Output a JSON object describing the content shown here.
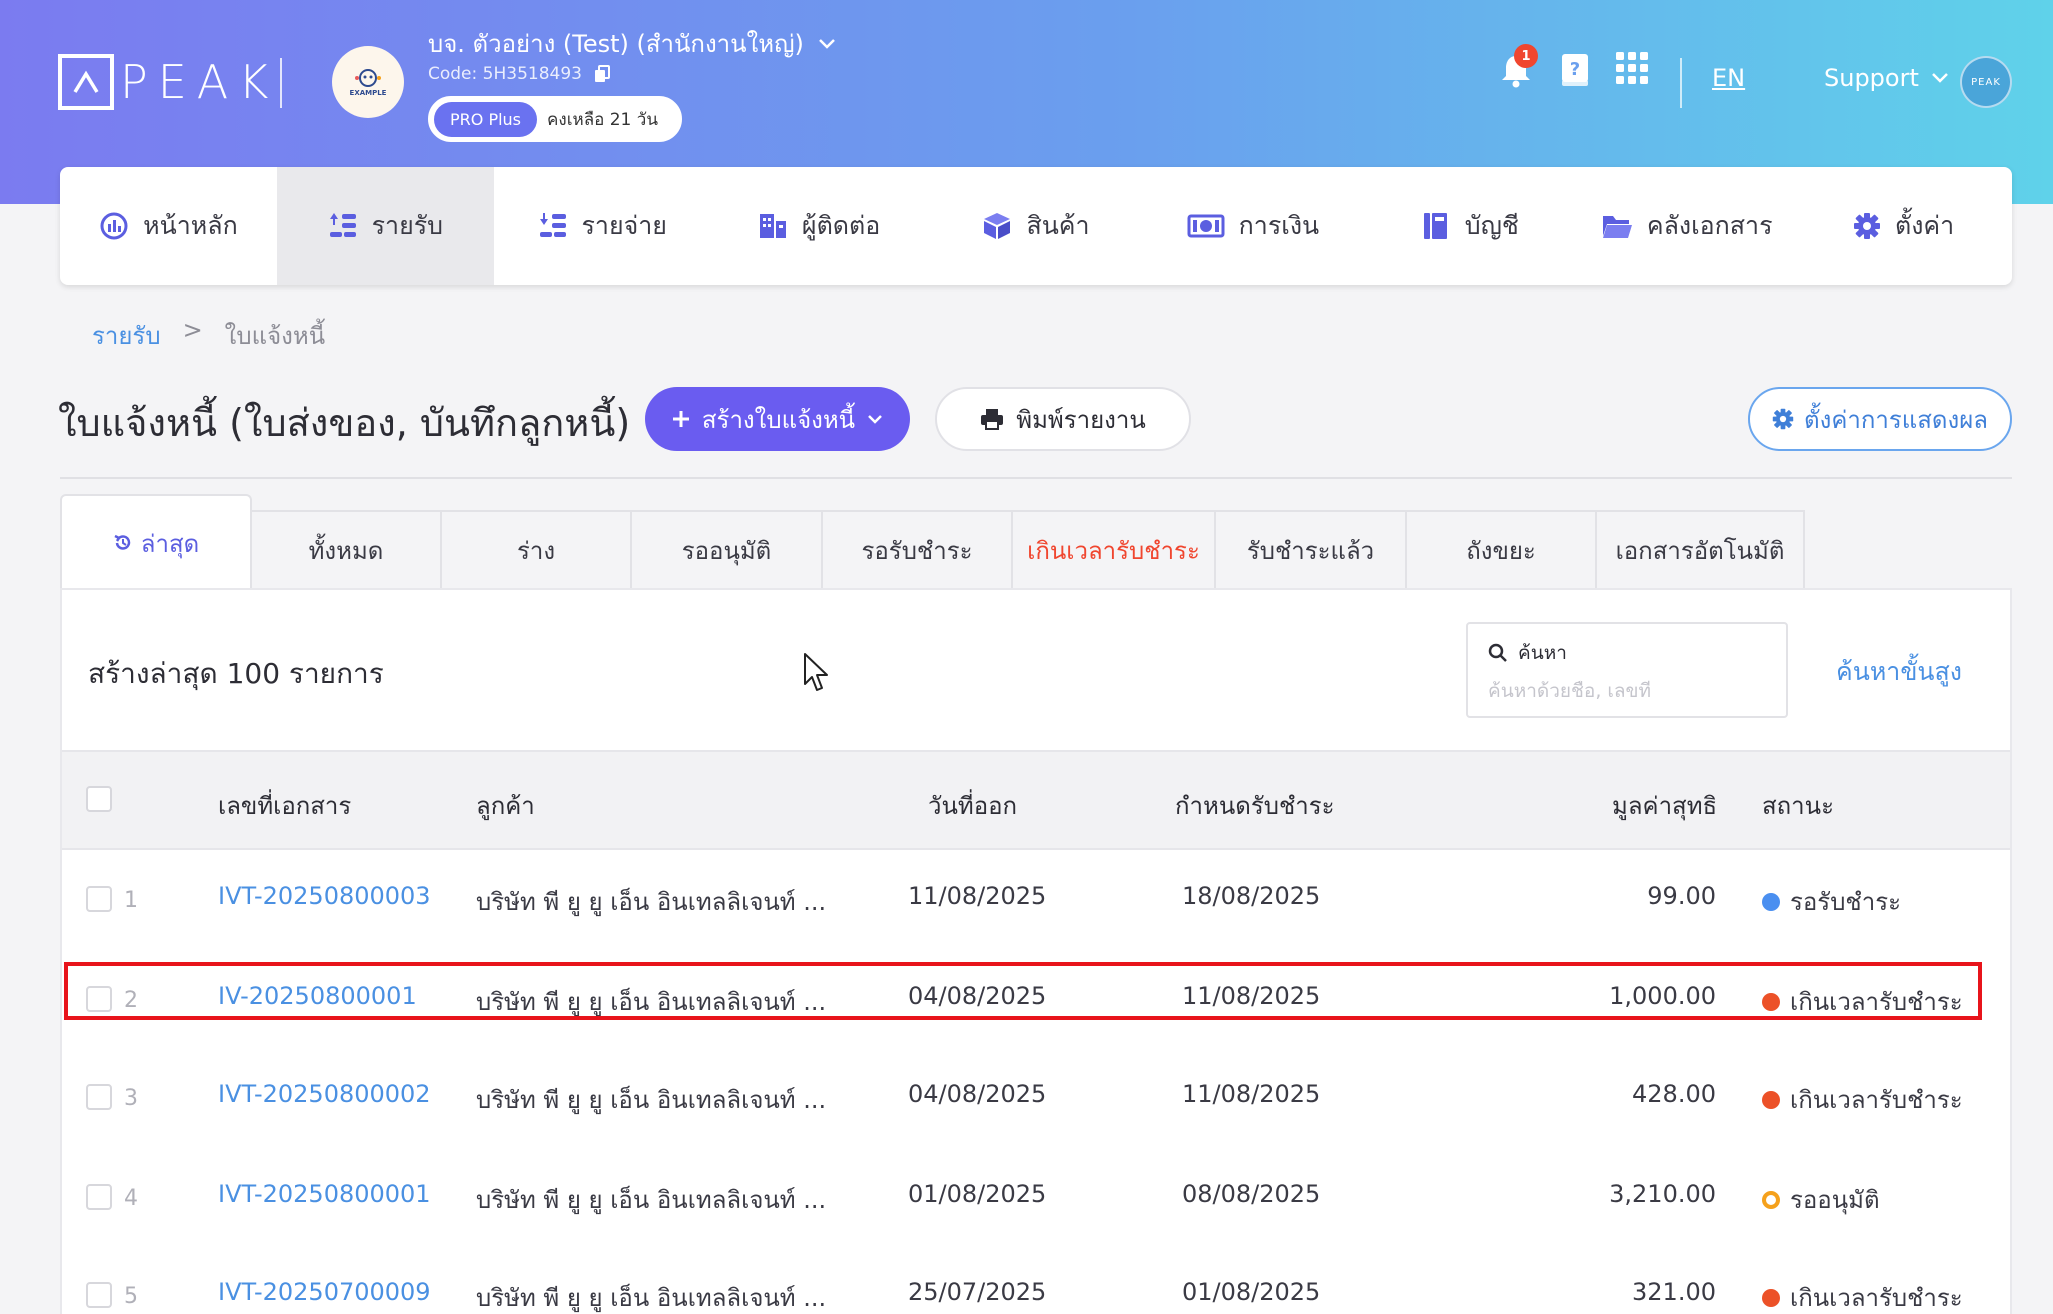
{
  "header": {
    "logo_text": "PEAK",
    "company_avatar_text": "EXAMPLE",
    "company_name": "บจ. ตัวอย่าง (Test) (สำนักงานใหญ่)",
    "company_code": "Code: 5H3518493",
    "plan": "PRO Plus",
    "days_left": "คงเหลือ 21 วัน",
    "notification_count": "1",
    "language": "EN",
    "support": "Support",
    "user_avatar_text": "PEAK"
  },
  "nav": {
    "items": [
      {
        "label": "หน้าหลัก",
        "icon": "dashboard-icon"
      },
      {
        "label": "รายรับ",
        "icon": "income-icon"
      },
      {
        "label": "รายจ่าย",
        "icon": "expense-icon"
      },
      {
        "label": "ผู้ติดต่อ",
        "icon": "contacts-icon"
      },
      {
        "label": "สินค้า",
        "icon": "product-icon"
      },
      {
        "label": "การเงิน",
        "icon": "finance-icon"
      },
      {
        "label": "บัญชี",
        "icon": "accounting-icon"
      },
      {
        "label": "คลังเอกสาร",
        "icon": "folder-icon"
      },
      {
        "label": "ตั้งค่า",
        "icon": "gear-icon"
      }
    ],
    "active_index": 1
  },
  "breadcrumb": {
    "parent": "รายรับ",
    "separator": ">",
    "current": "ใบแจ้งหนี้"
  },
  "page": {
    "title": "ใบแจ้งหนี้ (ใบส่งของ, บันทึกลูกหนี้)",
    "create_button": "สร้างใบแจ้งหนี้",
    "print_button": "พิมพ์รายงาน",
    "display_settings_button": "ตั้งค่าการแสดงผล"
  },
  "tabs": [
    {
      "label": "ล่าสุด",
      "width": 146
    },
    {
      "label": "ทั้งหมด",
      "width": 145
    },
    {
      "label": "ร่าง",
      "width": 145
    },
    {
      "label": "รออนุมัติ",
      "width": 146
    },
    {
      "label": "รอรับชำระ",
      "width": 145
    },
    {
      "label": "เกินเวลารับชำระ",
      "width": 155
    },
    {
      "label": "รับชำระแล้ว",
      "width": 146
    },
    {
      "label": "ถังขยะ",
      "width": 145
    },
    {
      "label": "เอกสารอัตโนมัติ",
      "width": 159
    }
  ],
  "list": {
    "summary": "สร้างล่าสุด 100 รายการ",
    "search_label": "ค้นหา",
    "search_placeholder": "ค้นหาด้วยชื่อ, เลขที่",
    "advanced_search": "ค้นหาขั้นสูง",
    "columns": {
      "doc_no": "เลขที่เอกสาร",
      "customer": "ลูกค้า",
      "issue_date": "วันที่ออก",
      "due_date": "กำหนดรับชำระ",
      "net_amount": "มูลค่าสุทธิ",
      "status": "สถานะ"
    },
    "rows": [
      {
        "num": "1",
        "doc": "IVT-20250800003",
        "customer": "บริษัท พี ยู ยู เอ็น อินเทลลิเจนท์ ...",
        "issue": "11/08/2025",
        "due": "18/08/2025",
        "amount": "99.00",
        "status": "รอรับชำระ",
        "status_color": "#4a8ff0",
        "ring": false
      },
      {
        "num": "2",
        "doc": "IV-20250800001",
        "customer": "บริษัท พี ยู ยู เอ็น อินเทลลิเจนท์ ...",
        "issue": "04/08/2025",
        "due": "11/08/2025",
        "amount": "1,000.00",
        "status": "เกินเวลารับชำระ",
        "status_color": "#ec5128",
        "ring": false
      },
      {
        "num": "3",
        "doc": "IVT-20250800002",
        "customer": "บริษัท พี ยู ยู เอ็น อินเทลลิเจนท์ ...",
        "issue": "04/08/2025",
        "due": "11/08/2025",
        "amount": "428.00",
        "status": "เกินเวลารับชำระ",
        "status_color": "#ec5128",
        "ring": false
      },
      {
        "num": "4",
        "doc": "IVT-20250800001",
        "customer": "บริษัท พี ยู ยู เอ็น อินเทลลิเจนท์ ...",
        "issue": "01/08/2025",
        "due": "08/08/2025",
        "amount": "3,210.00",
        "status": "รออนุมัติ",
        "status_color": "#f5a11c",
        "ring": true
      },
      {
        "num": "5",
        "doc": "IVT-20250700009",
        "customer": "บริษัท พี ยู ยู เอ็น อินเทลลิเจนท์ ...",
        "issue": "25/07/2025",
        "due": "01/08/2025",
        "amount": "321.00",
        "status": "เกินเวลารับชำระ",
        "status_color": "#ec5128",
        "ring": false
      }
    ]
  }
}
